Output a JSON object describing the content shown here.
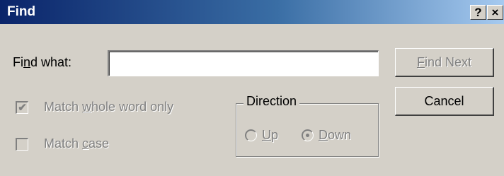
{
  "window": {
    "title": "Find",
    "help_button": "?",
    "close_button": "×"
  },
  "find_what": {
    "label_pre": "Fi",
    "label_accel": "n",
    "label_post": "d what:",
    "value": ""
  },
  "buttons": {
    "find_next_accel": "F",
    "find_next_rest": "ind Next",
    "cancel": "Cancel"
  },
  "options": {
    "whole_word": {
      "pre": "Match ",
      "accel": "w",
      "post": "hole word only",
      "checked": true,
      "enabled": false
    },
    "match_case": {
      "pre": "Match ",
      "accel": "c",
      "post": "ase",
      "checked": false,
      "enabled": false
    }
  },
  "direction": {
    "title": "Direction",
    "up_accel": "U",
    "up_rest": "p",
    "down_accel": "D",
    "down_rest": "own",
    "selected": "Down"
  },
  "colors": {
    "dialog_face": "#d4d0c8",
    "title_gradient_start": "#0a246a",
    "title_gradient_end": "#a6caf0",
    "disabled_text": "#808080"
  },
  "icons": {
    "checkmark": "check-icon",
    "help": "help-icon",
    "close": "close-icon"
  }
}
